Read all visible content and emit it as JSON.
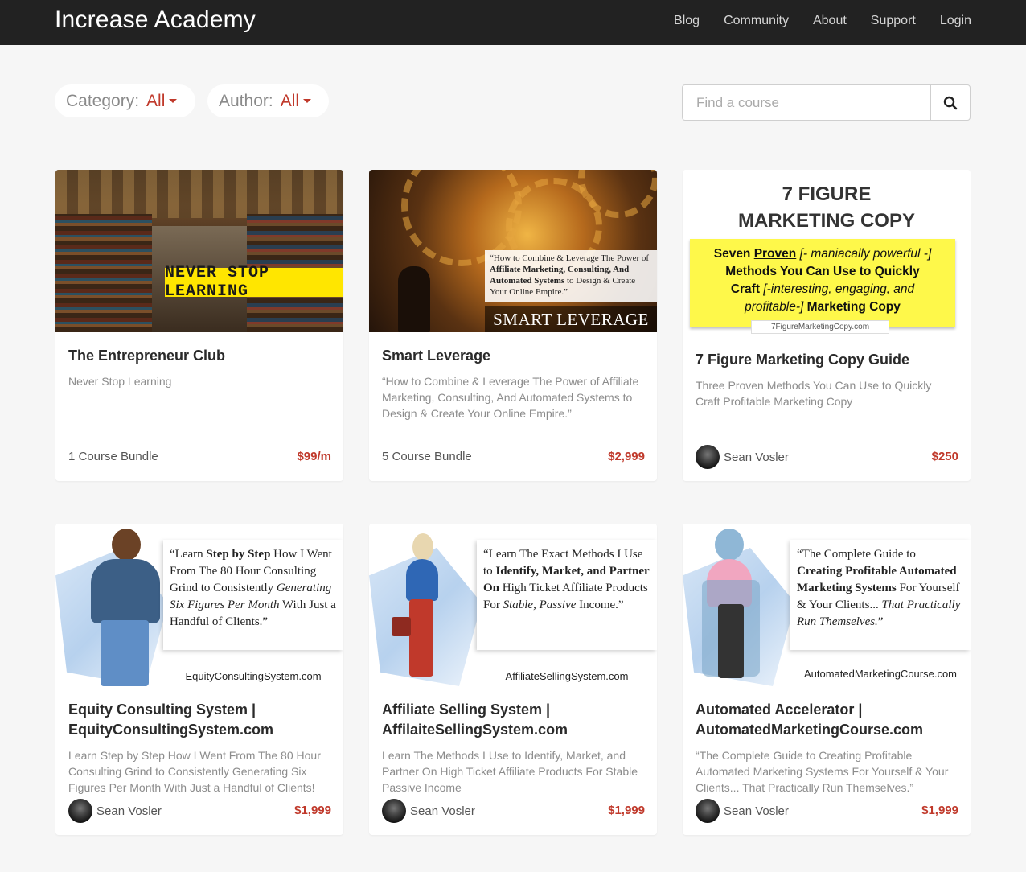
{
  "brand": "Increase Academy",
  "nav": [
    "Blog",
    "Community",
    "About",
    "Support",
    "Login"
  ],
  "filters": {
    "category": {
      "label": "Category:",
      "value": "All"
    },
    "author": {
      "label": "Author:",
      "value": "All"
    }
  },
  "search": {
    "placeholder": "Find a course",
    "icon": "search-icon"
  },
  "courses": [
    {
      "image_text": "NEVER STOP LEARNING",
      "title": "The Entrepreneur Club",
      "description": "Never Stop Learning",
      "meta": "1 Course Bundle",
      "price": "$99/m"
    },
    {
      "image_quote_pre": "“How to Combine & Leverage The Power of ",
      "image_quote_bold": "Affiliate Marketing, Consulting, And Automated Systems",
      "image_quote_post": " to Design & Create Your Online Empire.”",
      "image_band": "SMART LEVERAGE",
      "title": "Smart Leverage",
      "description": "“How to Combine & Leverage The Power of Affiliate Marketing, Consulting, And Automated Systems to Design & Create Your Online Empire.”",
      "meta": "5 Course Bundle",
      "price": "$2,999"
    },
    {
      "image_heading_1": "7 FIGURE",
      "image_heading_2": "MARKETING COPY",
      "image_l1_a": "Seven ",
      "image_l1_b": "Proven",
      "image_l1_c": " [- maniacally powerful -]",
      "image_l2": "Methods You Can Use to Quickly",
      "image_l3_a": "Craft",
      "image_l3_b": " [-interesting, engaging, and",
      "image_l4_a": "profitable-]",
      "image_l4_b": " Marketing Copy",
      "image_url": "7FigureMarketingCopy.com",
      "title": "7 Figure Marketing Copy Guide",
      "description": "Three Proven Methods You Can Use to Quickly Craft Profitable Marketing Copy",
      "author": "Sean Vosler",
      "price": "$250"
    },
    {
      "q1": "“Learn ",
      "q2": "Step by Step",
      "q3": " How I Went From The 80 Hour Consulting Grind to Consistently ",
      "q4": "Generating Six Figures Per Month",
      "q5": " With Just a Handful of Clients.”",
      "image_url": "EquityConsultingSystem.com",
      "title_1": "Equity Consulting System |",
      "title_2": "EquityConsultingSystem.com",
      "description": "Learn Step by Step How I Went From The 80 Hour Consulting Grind to Consistently Generating Six Figures Per Month With Just a Handful of Clients!",
      "author": "Sean Vosler",
      "price": "$1,999"
    },
    {
      "q1": "“Learn The Exact Methods I Use to ",
      "q2": "Identify, Market, and Partner On",
      "q3": " High Ticket Affiliate Products For ",
      "q4": "Stable, Passive",
      "q5": " Income.”",
      "image_url": "AffiliateSellingSystem.com",
      "title_1": "Affiliate Selling System |",
      "title_2": "AffilaiteSellingSystem.com",
      "description": "Learn The Methods I Use to Identify, Market, and Partner On High Ticket Affiliate Products For Stable Passive Income",
      "author": "Sean Vosler",
      "price": "$1,999"
    },
    {
      "q1": "“The Complete Guide to ",
      "q2": "Creating Profitable Automated Marketing Systems",
      "q3": " For Yourself & Your Clients... ",
      "q4": "That Practically Run Themselves.",
      "q5": "”",
      "image_url": "AutomatedMarketingCourse.com",
      "title_1": "Automated Accelerator |",
      "title_2": "AutomatedMarketingCourse.com",
      "description": "“The Complete Guide to Creating Profitable Automated Marketing Systems For Yourself & Your Clients... That Practically Run Themselves.”",
      "author": "Sean Vosler",
      "price": "$1,999"
    }
  ],
  "colors": {
    "navbar": "#222222",
    "accent": "#c0392b",
    "background": "#f6f6f6"
  }
}
